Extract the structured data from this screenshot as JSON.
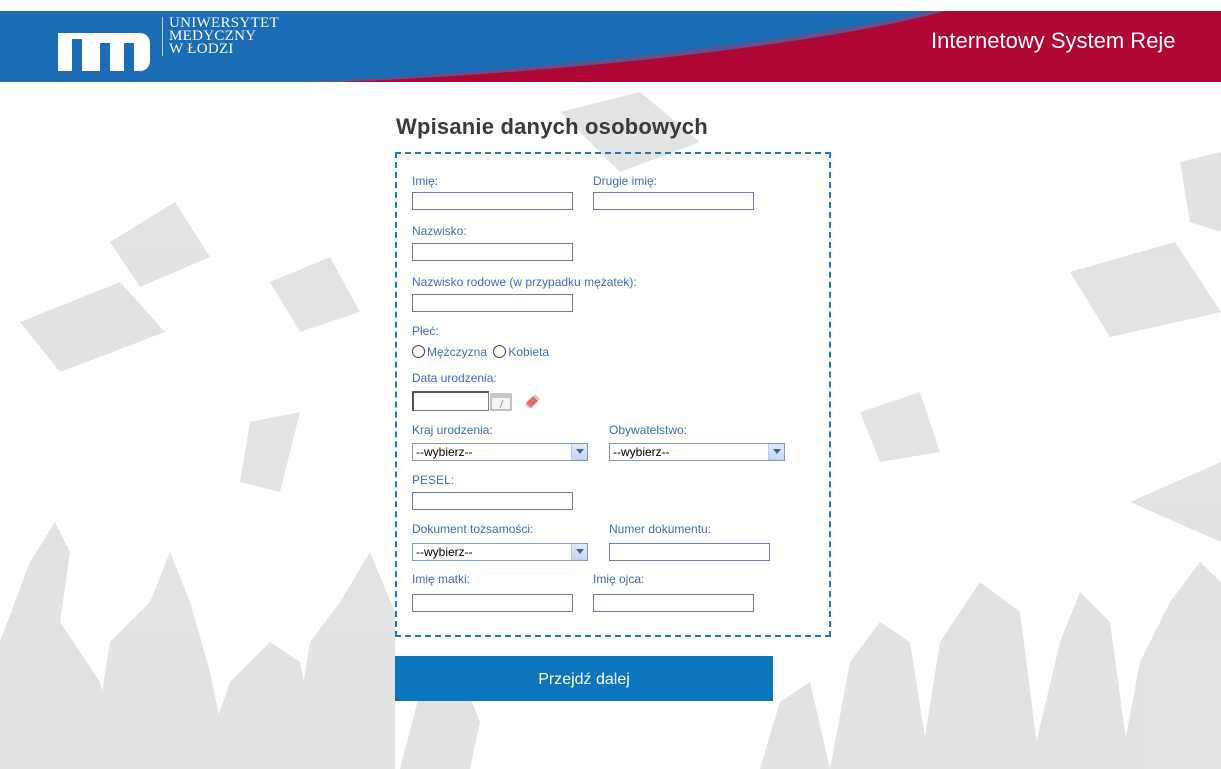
{
  "header": {
    "logo_mark": "um",
    "logo_lines": [
      "UNIWERSYTET",
      "MEDYCZNY",
      "W ŁODZI"
    ],
    "system_title": "Internetowy System Reje",
    "colors": {
      "blue": "#1a6cb5",
      "red": "#b00633"
    }
  },
  "form": {
    "title": "Wpisanie danych osobowych",
    "imie_label": "Imię:",
    "drugie_imie_label": "Drugie imię:",
    "nazwisko_label": "Nazwisko:",
    "nazwisko_rodowe_label": "Nazwisko rodowe (w przypadku mężatek):",
    "plec_label": "Płeć:",
    "plec_options": [
      "Mężczyzna",
      "Kobieta"
    ],
    "data_urodzenia_label": "Data urodzenia:",
    "kraj_urodzenia_label": "Kraj urodzenia:",
    "kraj_urodzenia_value": "--wybierz--",
    "obywatelstwo_label": "Obywatelstwo:",
    "obywatelstwo_value": "--wybierz--",
    "pesel_label": "PESEL:",
    "dokument_label": "Dokument tożsamości:",
    "dokument_value": "--wybierz--",
    "numer_dokumentu_label": "Numer dokumentu:",
    "imie_matki_label": "Imię matki:",
    "imie_ojca_label": "Imię ojca:",
    "submit_label": "Przejdź dalej"
  },
  "icons": [
    "calendar-icon",
    "eraser-icon",
    "chevron-down-icon"
  ]
}
